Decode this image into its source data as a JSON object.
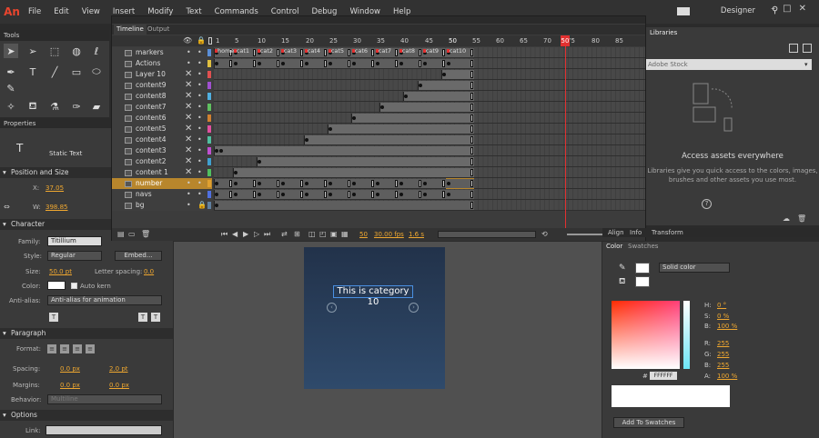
{
  "app": {
    "logo": "An",
    "workspace": "Designer"
  },
  "menu": [
    "File",
    "Edit",
    "View",
    "Insert",
    "Modify",
    "Text",
    "Commands",
    "Control",
    "Debug",
    "Window",
    "Help"
  ],
  "tools": {
    "title": "Tools"
  },
  "properties": {
    "title": "Properties",
    "text_type": "Static Text",
    "position_size": {
      "title": "Position and Size",
      "x_label": "X:",
      "x": "37.05",
      "w_label": "W:",
      "w": "398.85"
    },
    "character": {
      "title": "Character",
      "family_label": "Family:",
      "family": "Titillium",
      "style_label": "Style:",
      "style": "Regular",
      "embed": "Embed...",
      "size_label": "Size:",
      "size": "50.0 pt",
      "spacing_label": "Letter spacing:",
      "spacing": "0.0",
      "color_label": "Color:",
      "autokern": "Auto kern",
      "antialias_label": "Anti-alias:",
      "antialias": "Anti-alias for animation"
    },
    "paragraph": {
      "title": "Paragraph",
      "format_label": "Format:",
      "spacing_label": "Spacing:",
      "spacing_a": "0.0 px",
      "spacing_b": "2.0 pt",
      "margins_label": "Margins:",
      "margin_a": "0.0 px",
      "margin_b": "0.0 px",
      "behavior_label": "Behavior:",
      "behavior": "Multiline"
    },
    "options": {
      "title": "Options",
      "link_label": "Link:"
    }
  },
  "timeline": {
    "tabs": [
      "Timeline",
      "Output"
    ],
    "frame_numbers": [
      "1",
      "5",
      "10",
      "15",
      "20",
      "25",
      "30",
      "35",
      "40",
      "45",
      "50",
      "55",
      "60",
      "65",
      "70",
      "75",
      "80",
      "85"
    ],
    "labels": [
      "home",
      "cat1",
      "cat2",
      "cat3",
      "cat4",
      "cat5",
      "cat6",
      "cat7",
      "cat8",
      "cat9",
      "cat10"
    ],
    "layers": [
      {
        "name": "markers"
      },
      {
        "name": "Actions"
      },
      {
        "name": "Layer 10"
      },
      {
        "name": "content9"
      },
      {
        "name": "content8"
      },
      {
        "name": "content7"
      },
      {
        "name": "content6"
      },
      {
        "name": "content5"
      },
      {
        "name": "content4"
      },
      {
        "name": "content3"
      },
      {
        "name": "content2"
      },
      {
        "name": "content 1"
      },
      {
        "name": "number"
      },
      {
        "name": "navs"
      },
      {
        "name": "bg"
      }
    ],
    "current_frame": "50",
    "fps": "30.00 fps",
    "time": "1.6 s",
    "playhead_frame": "50"
  },
  "stage": {
    "text": "This is category 10"
  },
  "libraries": {
    "title": "Libraries",
    "select_placeholder": "Adobe Stock",
    "msg_title": "Access assets everywhere",
    "msg_body": "Libraries give you quick access to the colors, images, brushes and other assets you use most."
  },
  "transform_tabs": [
    "Align",
    "Info",
    "Transform"
  ],
  "color": {
    "tabs": [
      "Color",
      "Swatches"
    ],
    "fill_type": "Solid color",
    "h_label": "H:",
    "h": "0 °",
    "s_label": "S:",
    "s": "0 %",
    "b_label": "B:",
    "b": "100 %",
    "r_label": "R:",
    "r": "255",
    "g_label": "G:",
    "g": "255",
    "bb_label": "B:",
    "bb": "255",
    "hex_label": "#",
    "hex": "FFFFFF",
    "a_label": "A:",
    "a": "100 %",
    "add_swatches": "Add To Swatches"
  }
}
